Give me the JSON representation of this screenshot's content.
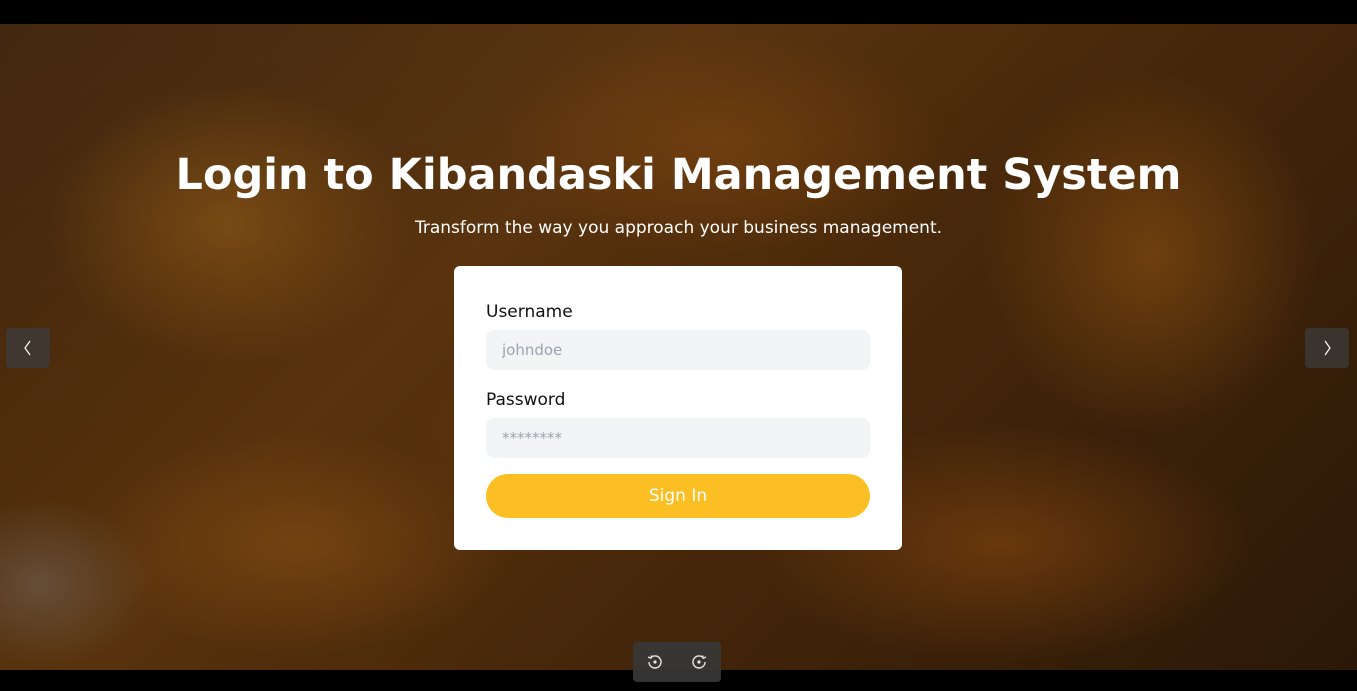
{
  "hero": {
    "title": "Login to Kibandaski Management System",
    "subtitle": "Transform the way you approach your business management."
  },
  "form": {
    "username_label": "Username",
    "username_placeholder": "johndoe",
    "password_label": "Password",
    "password_placeholder": "********",
    "submit_label": "Sign In"
  },
  "viewer": {
    "prev_icon": "chevron-left-icon",
    "next_icon": "chevron-right-icon",
    "tools": [
      "rotate-left-icon",
      "rotate-right-icon"
    ]
  },
  "colors": {
    "accent": "#fbbf24",
    "input_bg": "#f3f4f6",
    "card_bg": "#ffffff"
  }
}
